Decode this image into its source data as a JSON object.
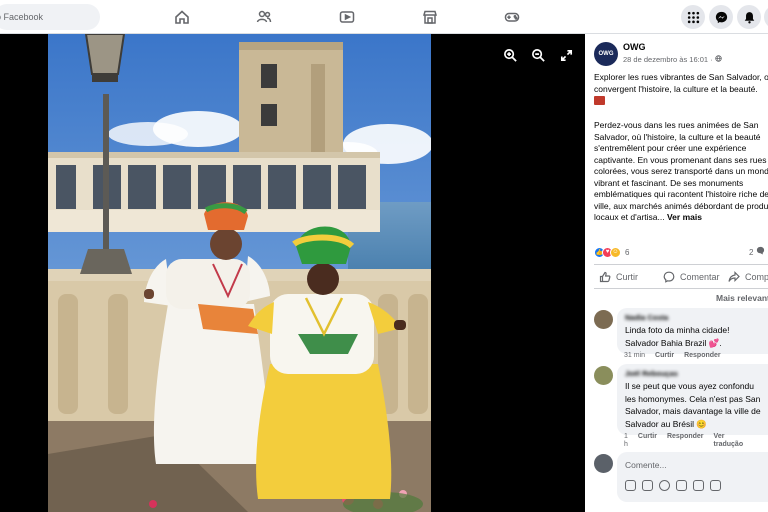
{
  "search": {
    "placeholder": "o Facebook"
  },
  "post": {
    "author": "OWG",
    "avatar_text": "OWG",
    "date": "28 de dezembro às 16:01 · ",
    "intro_line1": "Explorer les rues vibrantes de San Salvador, où",
    "intro_line2": "convergent l'histoire, la culture et la beauté.",
    "body_lines": [
      "Perdez-vous dans les rues animées de San",
      "Salvador, où l'histoire, la culture et la beauté",
      "s'entremêlent pour créer une expérience",
      "captivante. En vous promenant dans ses rues",
      "colorées, vous serez transporté dans un monde",
      "vibrant et fascinant. De ses monuments",
      "emblématiques qui racontent l'histoire riche de la",
      "ville, aux marchés animés débordant de produits",
      "locaux et d'artisa..."
    ],
    "see_more": "Ver mais",
    "reaction_count": "6",
    "comment_count": "2",
    "actions": {
      "like": "Curtir",
      "comment": "Comentar",
      "share": "Compartilhar"
    },
    "sort": "Mais relevantes"
  },
  "comments": [
    {
      "author": "Nadia Costa",
      "lines": [
        "Linda foto da minha cidade!",
        "Salvador Bahia Brazil 💕."
      ],
      "time": "31 min",
      "like": "Curtir",
      "reply": "Responder"
    },
    {
      "author": "Joël Rebouças",
      "lines": [
        "Il se peut que vous ayez confondu",
        "les homonymes. Cela n'est pas San",
        "Salvador, mais davantage la ville de",
        "Salvador au Brésil 😊"
      ],
      "time_a": "1",
      "time_b": "h",
      "like": "Curtir",
      "reply": "Responder",
      "translate_a": "Ver",
      "translate_b": "tradução"
    }
  ],
  "comment_input": {
    "placeholder": "Comente..."
  },
  "colors": {
    "brand": "#1877f2",
    "sky": "#3b76c9",
    "sea": "#4f87b4",
    "dress_yellow": "#f3cd3c",
    "avatar_navy": "#1b2a5a"
  },
  "icons": [
    "home-icon",
    "friends-icon",
    "watch-icon",
    "marketplace-icon",
    "gaming-icon",
    "menu-grid-icon",
    "messenger-icon",
    "bell-icon",
    "zoom-in-icon",
    "zoom-out-icon",
    "fullscreen-icon",
    "globe-icon",
    "like-icon",
    "comment-icon",
    "share-icon"
  ]
}
